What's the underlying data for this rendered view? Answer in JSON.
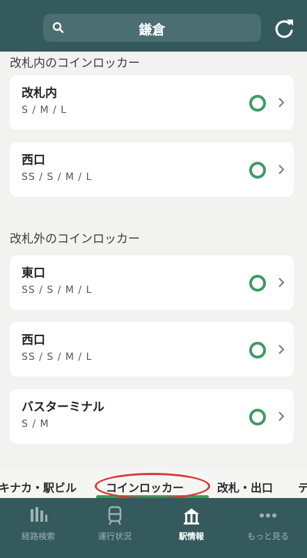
{
  "header": {
    "title": "鎌倉"
  },
  "sections": [
    {
      "heading": "改札内のコインロッカー",
      "lockers": [
        {
          "name": "改札内",
          "sizes": "S / M / L"
        },
        {
          "name": "西口",
          "sizes": "SS / S / M / L"
        }
      ]
    },
    {
      "heading": "改札外のコインロッカー",
      "lockers": [
        {
          "name": "東口",
          "sizes": "SS / S / M / L"
        },
        {
          "name": "西口",
          "sizes": "SS / S / M / L"
        },
        {
          "name": "バスターミナル",
          "sizes": "S / M"
        }
      ]
    }
  ],
  "tabs": [
    {
      "label": "キナカ・駅ビル"
    },
    {
      "label": "コインロッカー"
    },
    {
      "label": "改札・出口"
    },
    {
      "label": "テ"
    }
  ],
  "nav": [
    {
      "label": "経路検索",
      "icon": "bars-icon"
    },
    {
      "label": "運行状況",
      "icon": "train-icon"
    },
    {
      "label": "駅情報",
      "icon": "station-icon"
    },
    {
      "label": "もっと見る",
      "icon": "more-icon"
    }
  ],
  "colors": {
    "header": "#355a5d",
    "available": "#3f9a63",
    "highlight": "#d23b33",
    "indicator": "#3a9a5e"
  }
}
